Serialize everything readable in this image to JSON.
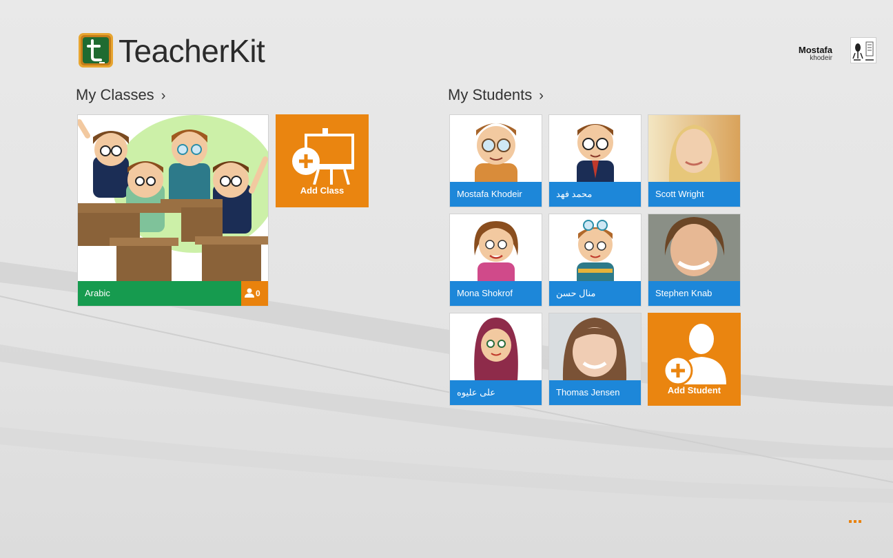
{
  "app": {
    "title": "TeacherKit"
  },
  "user": {
    "first_name": "Mostafa",
    "last_name": "khodeir"
  },
  "classes_section": {
    "heading": "My Classes",
    "classes": [
      {
        "name": "Arabic",
        "student_count": "0"
      }
    ],
    "add_label": "Add Class"
  },
  "students_section": {
    "heading": "My Students",
    "students": [
      {
        "name": "Mostafa Khodeir"
      },
      {
        "name": "محمد فهد"
      },
      {
        "name": "Scott Wright"
      },
      {
        "name": "Mona Shokrof"
      },
      {
        "name": "منال حسن"
      },
      {
        "name": "Stephen Knab"
      },
      {
        "name": "على عليوه"
      },
      {
        "name": "Thomas Jensen"
      }
    ],
    "add_label": "Add Student"
  },
  "colors": {
    "accent_orange": "#ea8510",
    "student_blue": "#1d87d9",
    "class_green": "#169b4f"
  }
}
